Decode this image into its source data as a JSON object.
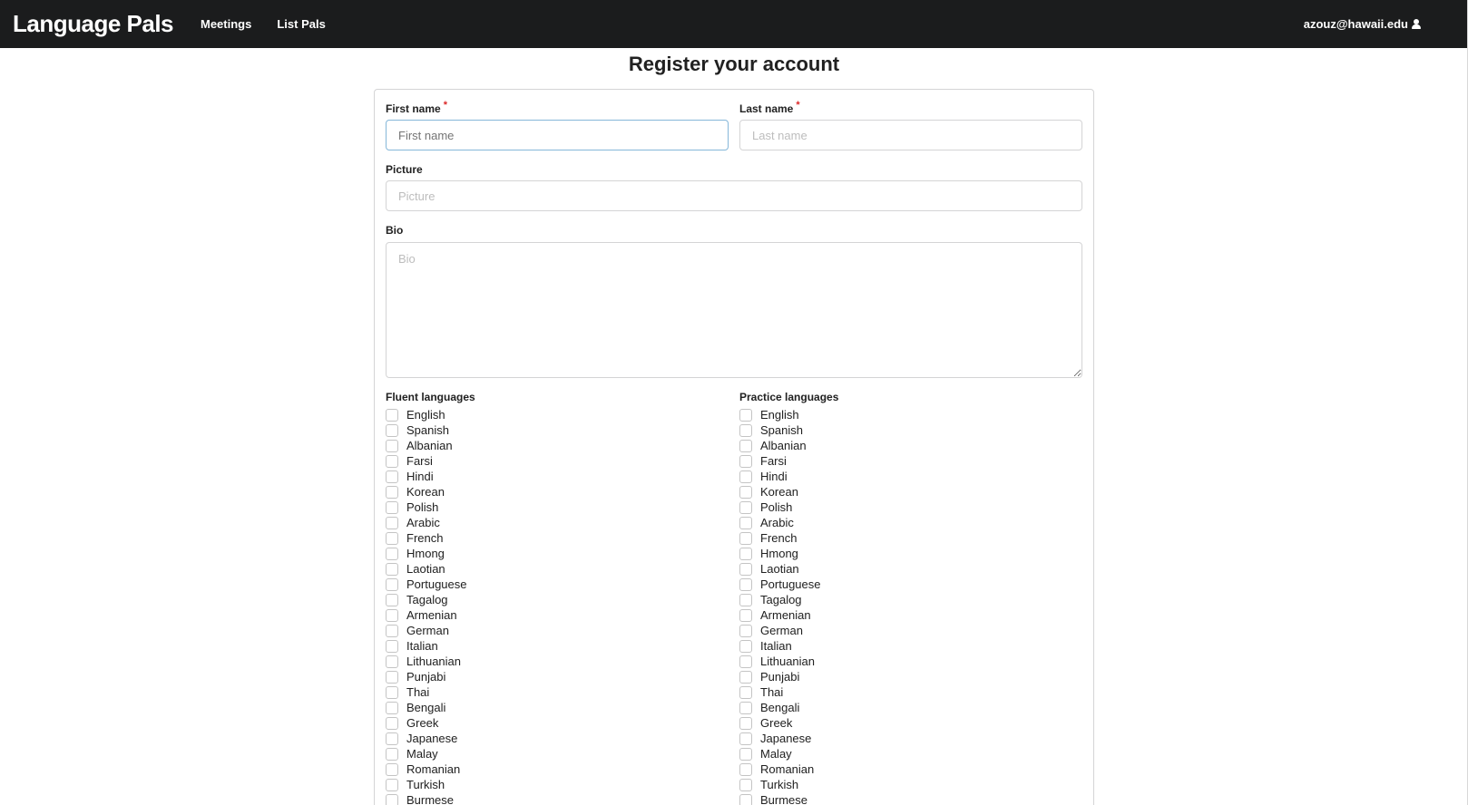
{
  "navbar": {
    "brand": "Language Pals",
    "links": [
      "Meetings",
      "List Pals"
    ],
    "user_email": "azouz@hawaii.edu",
    "user_icon": "user-icon"
  },
  "page": {
    "title": "Register your account"
  },
  "form": {
    "first_name": {
      "label": "First name",
      "required_mark": "*",
      "placeholder": "First name",
      "value": ""
    },
    "last_name": {
      "label": "Last name",
      "required_mark": "*",
      "placeholder": "Last name",
      "value": ""
    },
    "picture": {
      "label": "Picture",
      "placeholder": "Picture",
      "value": ""
    },
    "bio": {
      "label": "Bio",
      "placeholder": "Bio",
      "value": ""
    },
    "fluent_languages": {
      "label": "Fluent languages",
      "options": [
        "English",
        "Spanish",
        "Albanian",
        "Farsi",
        "Hindi",
        "Korean",
        "Polish",
        "Arabic",
        "French",
        "Hmong",
        "Laotian",
        "Portuguese",
        "Tagalog",
        "Armenian",
        "German",
        "Italian",
        "Lithuanian",
        "Punjabi",
        "Thai",
        "Bengali",
        "Greek",
        "Japanese",
        "Malay",
        "Romanian",
        "Turkish",
        "Burmese"
      ]
    },
    "practice_languages": {
      "label": "Practice languages",
      "options": [
        "English",
        "Spanish",
        "Albanian",
        "Farsi",
        "Hindi",
        "Korean",
        "Polish",
        "Arabic",
        "French",
        "Hmong",
        "Laotian",
        "Portuguese",
        "Tagalog",
        "Armenian",
        "German",
        "Italian",
        "Lithuanian",
        "Punjabi",
        "Thai",
        "Bengali",
        "Greek",
        "Japanese",
        "Malay",
        "Romanian",
        "Turkish",
        "Burmese"
      ]
    }
  }
}
